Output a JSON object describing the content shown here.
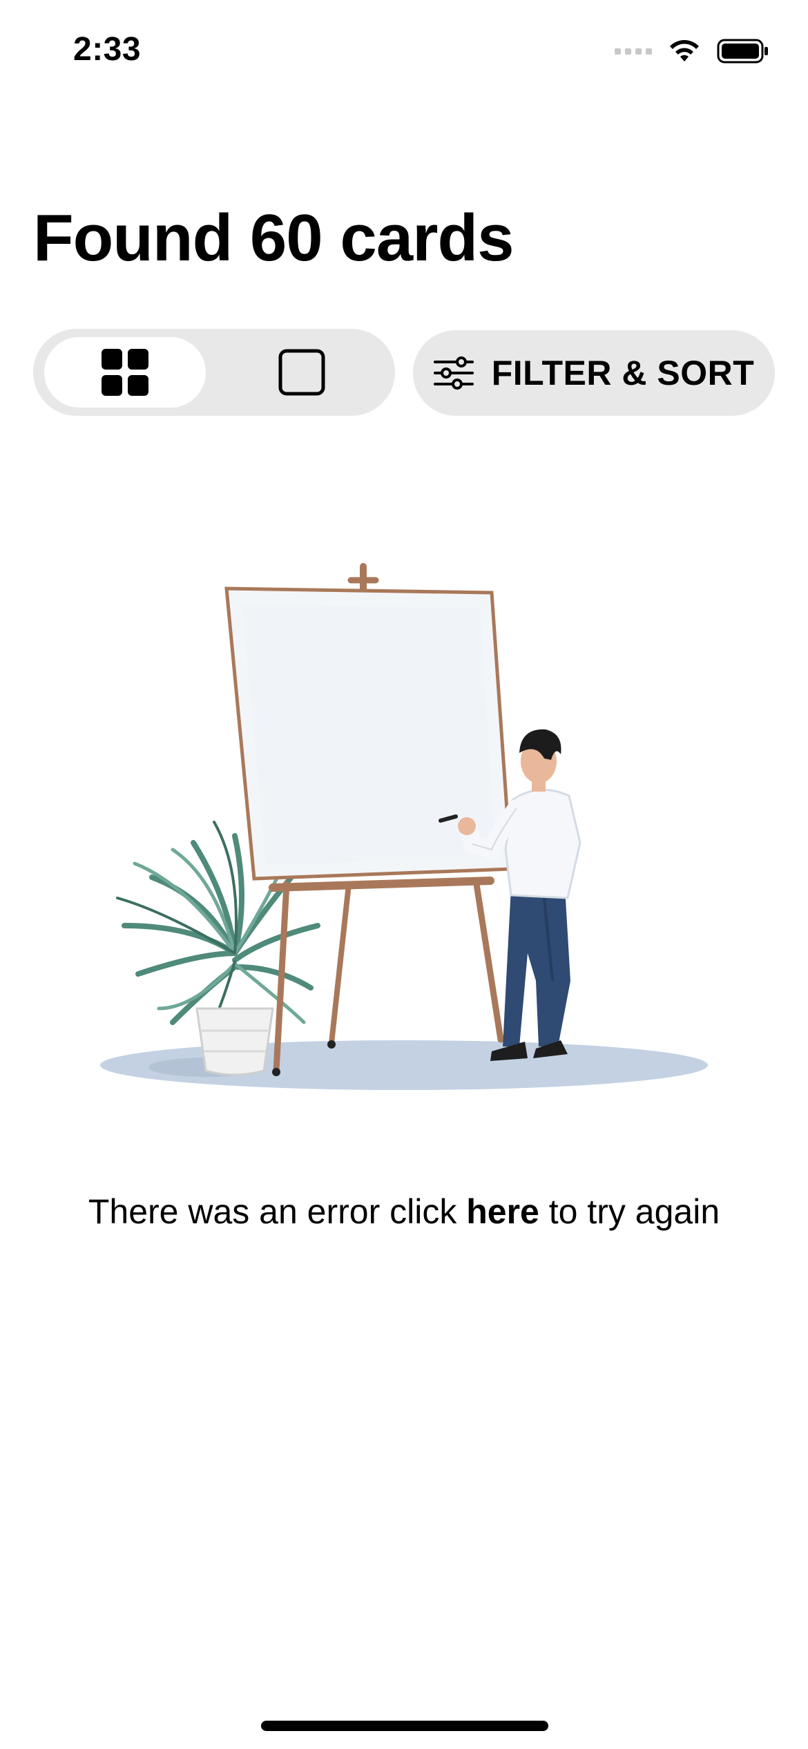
{
  "status_bar": {
    "time": "2:33",
    "icons": [
      "cellular-signal-icon",
      "wifi-icon",
      "battery-icon"
    ]
  },
  "header": {
    "title": "Found 60 cards"
  },
  "view_toggle": {
    "options": [
      {
        "name": "grid-view",
        "icon": "grid-icon",
        "selected": true
      },
      {
        "name": "single-view",
        "icon": "square-icon",
        "selected": false
      }
    ]
  },
  "filter": {
    "icon": "sliders-icon",
    "label": "FILTER & SORT"
  },
  "illustration": {
    "subject": "artist-at-easel-illustration"
  },
  "error": {
    "prefix": "There was an error click ",
    "link": "here",
    "suffix": " to try again"
  },
  "colors": {
    "background": "#ffffff",
    "pill_background": "#e8e8e8",
    "text": "#000000",
    "plant_green": "#4f8a7a",
    "easel_wood": "#a9785a",
    "jeans_blue": "#2f4a73",
    "floor_shadow": "#c3d1e3"
  }
}
